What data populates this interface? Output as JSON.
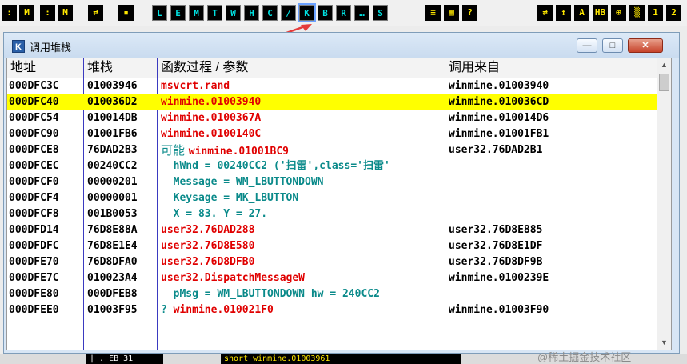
{
  "toolbar": {
    "left_buttons": [
      ":",
      "M",
      ":",
      "M",
      "⇄",
      "▪"
    ],
    "view_buttons": [
      "L",
      "E",
      "M",
      "T",
      "W",
      "H",
      "C",
      "/",
      "K",
      "B",
      "R",
      "…",
      "S"
    ],
    "mid_buttons": [
      "≡",
      "▦",
      "?"
    ],
    "right_buttons": [
      "⇄",
      "↕",
      "A",
      "HB",
      "⊕",
      "▒",
      "1",
      "2"
    ]
  },
  "window": {
    "icon_letter": "K",
    "title": "调用堆栈",
    "min_label": "—",
    "max_label": "□",
    "close_label": "✕"
  },
  "table": {
    "headers": [
      "地址",
      "堆栈",
      "函数过程 / 参数",
      "调用来自"
    ],
    "rows": [
      {
        "addr": "000DFC3C",
        "stack": "01003946",
        "proc_pre": "",
        "proc": "msvcrt.rand",
        "proc_style": "red",
        "from": "winmine.01003940",
        "selected": false
      },
      {
        "addr": "000DFC40",
        "stack": "010036D2",
        "proc_pre": "",
        "proc": "winmine.01003940",
        "proc_style": "red",
        "from": "winmine.010036CD",
        "selected": true
      },
      {
        "addr": "000DFC54",
        "stack": "010014DB",
        "proc_pre": "",
        "proc": "winmine.0100367A",
        "proc_style": "red",
        "from": "winmine.010014D6",
        "selected": false
      },
      {
        "addr": "000DFC90",
        "stack": "01001FB6",
        "proc_pre": "",
        "proc": "winmine.0100140C",
        "proc_style": "red",
        "from": "winmine.01001FB1",
        "selected": false
      },
      {
        "addr": "000DFCE8",
        "stack": "76DAD2B3",
        "proc_pre": "可能 ",
        "proc": "winmine.01001BC9",
        "proc_style": "red",
        "from": "user32.76DAD2B1",
        "selected": false
      },
      {
        "addr": "000DFCEC",
        "stack": "00240CC2",
        "proc_pre": "",
        "proc": "  hWnd = 00240CC2 ('扫雷',class='扫雷'",
        "proc_style": "teal",
        "from": "",
        "selected": false
      },
      {
        "addr": "000DFCF0",
        "stack": "00000201",
        "proc_pre": "",
        "proc": "  Message = WM_LBUTTONDOWN",
        "proc_style": "teal",
        "from": "",
        "selected": false
      },
      {
        "addr": "000DFCF4",
        "stack": "00000001",
        "proc_pre": "",
        "proc": "  Keysage = MK_LBUTTON",
        "proc_style": "teal",
        "from": "",
        "selected": false
      },
      {
        "addr": "000DFCF8",
        "stack": "001B0053",
        "proc_pre": "",
        "proc": "  X = 83. Y = 27.",
        "proc_style": "teal",
        "from": "",
        "selected": false
      },
      {
        "addr": "000DFD14",
        "stack": "76D8E88A",
        "proc_pre": "",
        "proc": "user32.76DAD288",
        "proc_style": "red",
        "from": "user32.76D8E885",
        "selected": false
      },
      {
        "addr": "000DFDFC",
        "stack": "76D8E1E4",
        "proc_pre": "",
        "proc": "user32.76D8E580",
        "proc_style": "red",
        "from": "user32.76D8E1DF",
        "selected": false
      },
      {
        "addr": "000DFE70",
        "stack": "76D8DFA0",
        "proc_pre": "",
        "proc": "user32.76D8DFB0",
        "proc_style": "red",
        "from": "user32.76D8DF9B",
        "selected": false
      },
      {
        "addr": "000DFE7C",
        "stack": "010023A4",
        "proc_pre": "",
        "proc": "user32.DispatchMessageW",
        "proc_style": "red",
        "from": "winmine.0100239E",
        "selected": false
      },
      {
        "addr": "000DFE80",
        "stack": "000DFEB8",
        "proc_pre": "",
        "proc": "  pMsg = WM_LBUTTONDOWN hw = 240CC2",
        "proc_style": "teal",
        "from": "",
        "selected": false
      },
      {
        "addr": "000DFEE0",
        "stack": "01003F95",
        "proc_pre": "? ",
        "proc": "winmine.010021F0",
        "proc_style": "red",
        "from": "winmine.01003F90",
        "selected": false
      }
    ]
  },
  "bottom_strip": {
    "left_text": "| . EB 31",
    "right_text": "short winmine.01003961"
  },
  "watermark": "@稀土掘金技术社区",
  "colors": {
    "selected_row": "#ffff00",
    "proc_red": "#e00000",
    "param_teal": "#0a8a8a",
    "column_line": "#3a3ac0"
  }
}
